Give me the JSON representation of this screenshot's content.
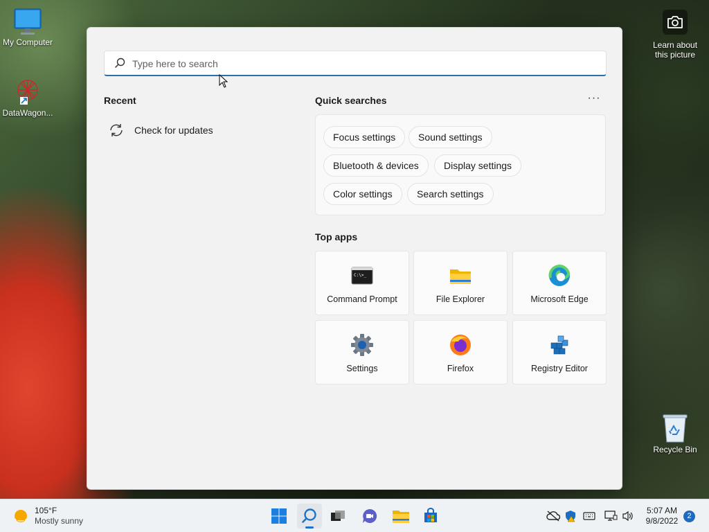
{
  "desktop": {
    "icons": [
      {
        "label": "My Computer",
        "icon": "monitor-icon"
      },
      {
        "label": "DataWagon...",
        "icon": "datawagon-icon"
      },
      {
        "label": "Recycle Bin",
        "icon": "recycle-bin-icon"
      }
    ],
    "spotlight": {
      "label_line1": "Learn about",
      "label_line2": "this picture",
      "icon": "camera-icon"
    }
  },
  "search": {
    "placeholder": "Type here to search",
    "icon": "search-icon"
  },
  "recent": {
    "heading": "Recent",
    "items": [
      {
        "label": "Check for updates",
        "icon": "refresh-icon"
      }
    ]
  },
  "quick_searches": {
    "heading": "Quick searches",
    "more_label": "···",
    "chips": [
      {
        "label": "Focus settings"
      },
      {
        "label": "Sound settings"
      },
      {
        "label": "Bluetooth & devices"
      },
      {
        "label": "Display settings"
      },
      {
        "label": "Color settings"
      },
      {
        "label": "Search settings"
      }
    ]
  },
  "top_apps": {
    "heading": "Top apps",
    "apps": [
      {
        "label": "Command Prompt",
        "icon": "command-prompt-icon"
      },
      {
        "label": "File Explorer",
        "icon": "folder-icon"
      },
      {
        "label": "Microsoft Edge",
        "icon": "edge-icon"
      },
      {
        "label": "Settings",
        "icon": "gear-icon"
      },
      {
        "label": "Firefox",
        "icon": "firefox-icon"
      },
      {
        "label": "Registry Editor",
        "icon": "registry-icon"
      }
    ]
  },
  "taskbar": {
    "weather": {
      "temp": "105°F",
      "condition": "Mostly sunny"
    },
    "pinned": [
      "start-icon",
      "search-icon",
      "task-view-icon",
      "chat-icon",
      "file-explorer-icon",
      "store-icon"
    ],
    "tray": [
      "cloud-offline-icon",
      "security-icon",
      "keyboard-icon",
      "network-icon",
      "volume-icon"
    ],
    "clock": {
      "time": "5:07 AM",
      "date": "9/8/2022"
    },
    "notifications": "2"
  },
  "colors": {
    "accent": "#1a73c8",
    "search_underline": "#2b6ea8",
    "panel_bg": "#f2f2f2"
  }
}
